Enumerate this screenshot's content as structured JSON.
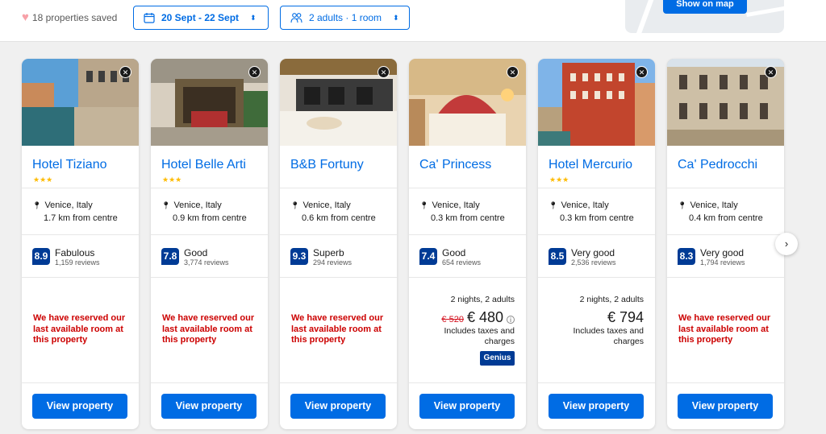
{
  "header": {
    "saved_text": "18 properties saved",
    "dates_label": "20 Sept - 22 Sept",
    "guests_label": "2 adults · 1 room",
    "map_button_label": "Show on map"
  },
  "colors": {
    "brand_blue": "#006ce4",
    "score_blue": "#003b95",
    "alert_red": "#cc0000",
    "stars": "#febb02"
  },
  "cards": [
    {
      "name": "Hotel Tiziano",
      "stars": "★★★",
      "location": "Venice, Italy",
      "distance": "1.7 km from centre",
      "score": "8.9",
      "score_word": "Fabulous",
      "reviews": "1,159 reviews",
      "reserved_message": "We have reserved our last available room at this property",
      "cta": "View property"
    },
    {
      "name": "Hotel Belle Arti",
      "stars": "★★★",
      "location": "Venice, Italy",
      "distance": "0.9 km from centre",
      "score": "7.8",
      "score_word": "Good",
      "reviews": "3,774 reviews",
      "reserved_message": "We have reserved our last available room at this property",
      "cta": "View property"
    },
    {
      "name": "B&B Fortuny",
      "stars": "",
      "location": "Venice, Italy",
      "distance": "0.6 km from centre",
      "score": "9.3",
      "score_word": "Superb",
      "reviews": "294 reviews",
      "reserved_message": "We have reserved our last available room at this property",
      "cta": "View property"
    },
    {
      "name": "Ca' Princess",
      "stars": "",
      "location": "Venice, Italy",
      "distance": "0.3 km from centre",
      "score": "7.4",
      "score_word": "Good",
      "reviews": "654 reviews",
      "nights": "2 nights, 2 adults",
      "old_price": "€ 520",
      "price": "€ 480",
      "taxes": "Includes taxes and charges",
      "genius": "Genius",
      "cta": "View property"
    },
    {
      "name": "Hotel Mercurio",
      "stars": "★★★",
      "location": "Venice, Italy",
      "distance": "0.3 km from centre",
      "score": "8.5",
      "score_word": "Very good",
      "reviews": "2,536 reviews",
      "nights": "2 nights, 2 adults",
      "price": "€ 794",
      "taxes": "Includes taxes and charges",
      "cta": "View property"
    },
    {
      "name": "Ca' Pedrocchi",
      "stars": "",
      "location": "Venice, Italy",
      "distance": "0.4 km from centre",
      "score": "8.3",
      "score_word": "Very good",
      "reviews": "1,794 reviews",
      "reserved_message": "We have reserved our last available room at this property",
      "cta": "View property"
    }
  ],
  "icons": {
    "heart": "heart-icon",
    "calendar": "calendar-icon",
    "guests": "people-icon",
    "close": "close-icon",
    "pin": "map-pin-icon",
    "next": "chevron-right-icon"
  }
}
